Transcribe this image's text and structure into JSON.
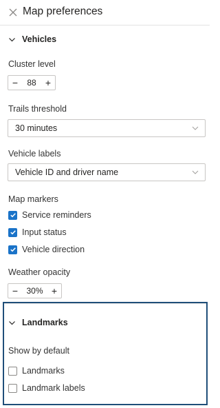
{
  "header": {
    "title": "Map preferences",
    "close_icon": "close-icon"
  },
  "vehicles_section": {
    "heading": "Vehicles",
    "cluster_level": {
      "label": "Cluster level",
      "value": "88",
      "decrement": "−",
      "increment": "+"
    },
    "trails_threshold": {
      "label": "Trails threshold",
      "selected": "30 minutes"
    },
    "vehicle_labels": {
      "label": "Vehicle labels",
      "selected": "Vehicle ID and driver name"
    },
    "map_markers": {
      "label": "Map markers",
      "items": [
        {
          "label": "Service reminders",
          "checked": true
        },
        {
          "label": "Input status",
          "checked": true
        },
        {
          "label": "Vehicle direction",
          "checked": true
        }
      ]
    },
    "weather_opacity": {
      "label": "Weather opacity",
      "value": "30%",
      "decrement": "−",
      "increment": "+"
    }
  },
  "landmarks_section": {
    "heading": "Landmarks",
    "show_by_default": "Show by default",
    "items": [
      {
        "label": "Landmarks",
        "checked": false
      },
      {
        "label": "Landmark labels",
        "checked": false
      }
    ]
  },
  "colors": {
    "accent": "#1a73c8",
    "highlight_border": "#1f4e79",
    "divider": "#e3e3e3"
  }
}
